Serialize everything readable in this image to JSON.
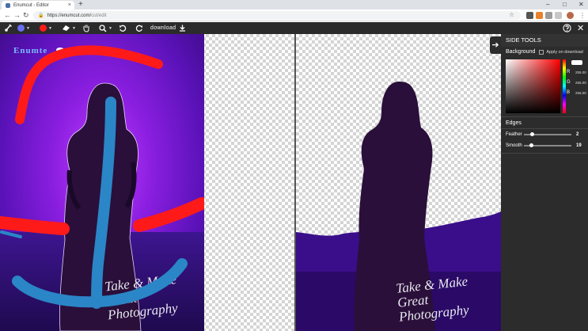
{
  "browser": {
    "tab_title": "Enumcut - Editor",
    "tab_close": "×",
    "new_tab": "+",
    "win_min": "–",
    "win_max": "□",
    "win_close": "✕",
    "url_host": "https://enumcut.com/",
    "url_path": "cut/edit",
    "back": "←",
    "forward": "→",
    "reload": "↻",
    "lock": "🔒",
    "bookmark": "☆"
  },
  "toolbar": {
    "download_label": "download"
  },
  "canvas": {
    "logo_text": "Enumte",
    "signature_line1": "Take & Make",
    "signature_line2": "Great Photography"
  },
  "side_tools": {
    "title": "SIDE TOOLS",
    "background_label": "Background",
    "apply_on_download": "Apply on download",
    "r_label": "R",
    "r_value": "255.00",
    "g_label": "G",
    "g_value": "255.00",
    "b_label": "B",
    "b_value": "255.00",
    "edges_label": "Edges",
    "feather_label": "Feather",
    "feather_value": "2",
    "smooth_label": "Smooth",
    "smooth_value": "19"
  },
  "colors": {
    "brush_blue": "#2a86c6",
    "brush_red": "#ff1a1a",
    "background_color": "#ffffff"
  }
}
